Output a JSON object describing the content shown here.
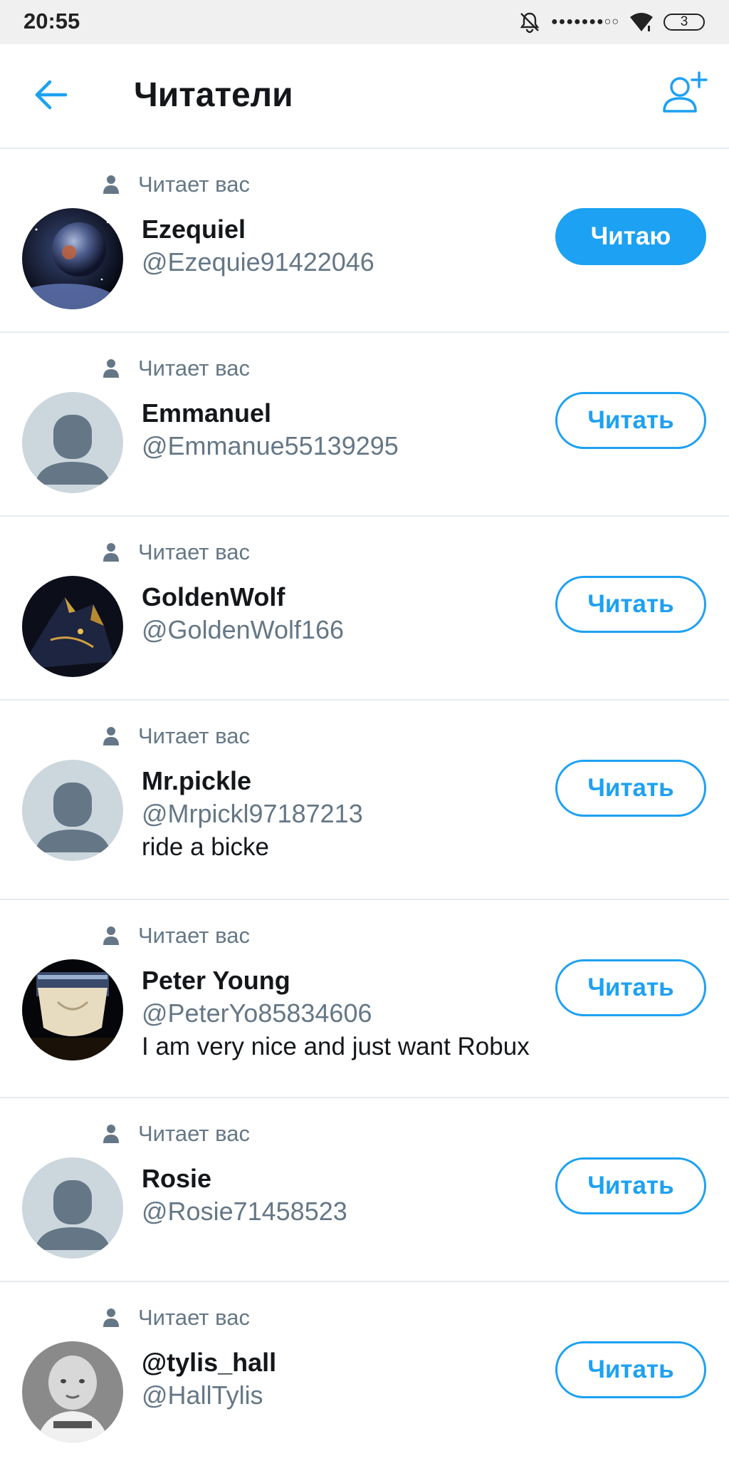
{
  "status_bar": {
    "time": "20:55",
    "signal": "●●●●●●●○○",
    "battery": "3",
    "icons": [
      "mute-bell-icon",
      "wifi-icon",
      "battery-icon"
    ]
  },
  "header": {
    "title": "Читатели",
    "back_icon": "arrow-left-icon",
    "add_icon": "add-user-icon"
  },
  "colors": {
    "accent": "#1da1f2",
    "secondary_text": "#657786",
    "divider": "#e6ecf0"
  },
  "followers": [
    {
      "follows_label": "Читает вас",
      "name": "Ezequiel",
      "handle": "@Ezequie91422046",
      "bio": "",
      "button": "Читаю",
      "following": true,
      "avatar": "space-planet-photo"
    },
    {
      "follows_label": "Читает вас",
      "name": "Emmanuel",
      "handle": "@Emmanue55139295",
      "bio": "",
      "button": "Читать",
      "following": false,
      "avatar": "default-avatar"
    },
    {
      "follows_label": "Читает вас",
      "name": "GoldenWolf",
      "handle": "@GoldenWolf166",
      "bio": "",
      "button": "Читать",
      "following": false,
      "avatar": "dark-wolf-photo"
    },
    {
      "follows_label": "Читает вас",
      "name": "Mr.pickle",
      "handle": "@Mrpickl97187213",
      "bio": "ride a bicke",
      "button": "Читать",
      "following": false,
      "avatar": "default-avatar"
    },
    {
      "follows_label": "Читает вас",
      "name": "Peter Young",
      "handle": "@PeterYo85834606",
      "bio": "I am very nice and just want Robux",
      "button": "Читать",
      "following": false,
      "avatar": "game-character-photo"
    },
    {
      "follows_label": "Читает вас",
      "name": "Rosie",
      "handle": "@Rosie71458523",
      "bio": "",
      "button": "Читать",
      "following": false,
      "avatar": "default-avatar"
    },
    {
      "follows_label": "Читает вас",
      "name": "@tylis_hall",
      "handle": "@HallTylis",
      "bio": "",
      "button": "Читать",
      "following": false,
      "avatar": "baby-photo"
    }
  ]
}
